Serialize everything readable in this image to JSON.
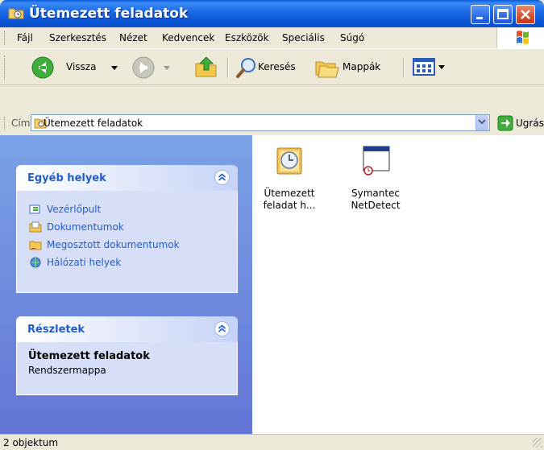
{
  "window": {
    "title": "Ütemezett feladatok"
  },
  "menu": {
    "items": [
      "Fájl",
      "Szerkesztés",
      "Nézet",
      "Kedvencek",
      "Eszközök",
      "Speciális",
      "Súgó"
    ]
  },
  "toolbar": {
    "back_label": "Vissza",
    "search_label": "Keresés",
    "folders_label": "Mappák"
  },
  "address": {
    "label": "Cím",
    "value": "Ütemezett feladatok",
    "go_label": "Ugrás"
  },
  "taskpane": {
    "other_places": {
      "title": "Egyéb helyek",
      "links": [
        "Vezérlőpult",
        "Dokumentumok",
        "Megosztott dokumentumok",
        "Hálózati helyek"
      ]
    },
    "details": {
      "title": "Részletek",
      "name": "Ütemezett feladatok",
      "type": "Rendszermappa"
    }
  },
  "files": [
    {
      "line1": "Ütemezett",
      "line2": "feladat h...",
      "icon": "add-scheduled-task-icon"
    },
    {
      "line1": "Symantec",
      "line2": "NetDetect",
      "icon": "scheduled-task-icon"
    }
  ],
  "status": {
    "text": "2 objektum"
  },
  "colors": {
    "title_bar": "#0A5BDB",
    "task_pane": "#7BA2E7",
    "link": "#215DC6",
    "menu_bg": "#ECE9D8"
  }
}
